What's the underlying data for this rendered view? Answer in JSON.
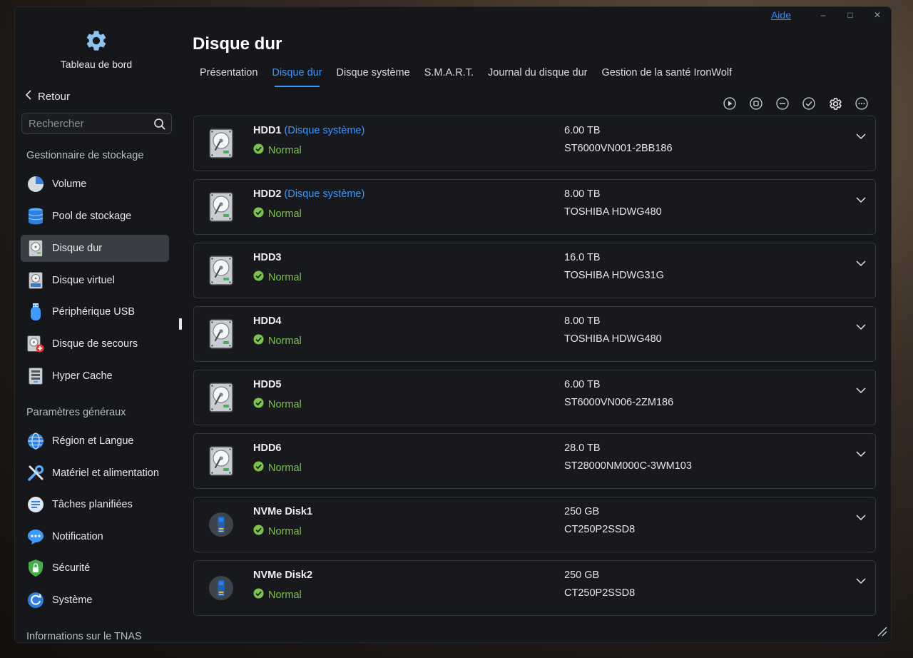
{
  "window": {
    "help_label": "Aide",
    "minimize_glyph": "–",
    "maximize_glyph": "□",
    "close_glyph": "✕"
  },
  "sidebar": {
    "dashboard_label": "Tableau de bord",
    "dashboard_icon": "gear-icon",
    "back_label": "Retour",
    "search_placeholder": "Rechercher",
    "storage_section": "Gestionnaire de stockage",
    "storage_items": [
      {
        "label": "Volume",
        "icon": "volume-pie-icon"
      },
      {
        "label": "Pool de stockage",
        "icon": "storage-pool-icon"
      },
      {
        "label": "Disque dur",
        "icon": "hard-disk-icon",
        "active": true
      },
      {
        "label": "Disque virtuel",
        "icon": "virtual-disk-icon"
      },
      {
        "label": "Périphérique USB",
        "icon": "usb-device-icon"
      },
      {
        "label": "Disque de secours",
        "icon": "spare-disk-icon"
      },
      {
        "label": "Hyper Cache",
        "icon": "hyper-cache-icon"
      }
    ],
    "general_section": "Paramètres généraux",
    "general_items": [
      {
        "label": "Région et Langue",
        "icon": "globe-icon"
      },
      {
        "label": "Matériel et alimentation",
        "icon": "tools-icon"
      },
      {
        "label": "Tâches planifiées",
        "icon": "tasks-icon"
      },
      {
        "label": "Notification",
        "icon": "chat-bubble-icon"
      },
      {
        "label": "Sécurité",
        "icon": "shield-lock-icon"
      },
      {
        "label": "Système",
        "icon": "system-refresh-icon"
      }
    ],
    "info_section": "Informations sur le TNAS"
  },
  "main": {
    "title": "Disque dur",
    "tabs": [
      "Présentation",
      "Disque dur",
      "Disque système",
      "S.M.A.R.T.",
      "Journal du disque dur",
      "Gestion de la santé IronWolf"
    ],
    "active_tab": 1,
    "toolbar_icons": [
      "play-circle-icon",
      "stop-circle-icon",
      "minus-circle-icon",
      "check-circle-icon",
      "gear-icon",
      "more-circle-icon"
    ],
    "disks": [
      {
        "name": "HDD1",
        "tag": "(Disque système)",
        "status": "Normal",
        "size": "6.00 TB",
        "model": "ST6000VN001-2BB186",
        "type": "hdd"
      },
      {
        "name": "HDD2",
        "tag": "(Disque système)",
        "status": "Normal",
        "size": "8.00 TB",
        "model": "TOSHIBA HDWG480",
        "type": "hdd"
      },
      {
        "name": "HDD3",
        "tag": "",
        "status": "Normal",
        "size": "16.0 TB",
        "model": "TOSHIBA HDWG31G",
        "type": "hdd"
      },
      {
        "name": "HDD4",
        "tag": "",
        "status": "Normal",
        "size": "8.00 TB",
        "model": "TOSHIBA HDWG480",
        "type": "hdd"
      },
      {
        "name": "HDD5",
        "tag": "",
        "status": "Normal",
        "size": "6.00 TB",
        "model": "ST6000VN006-2ZM186",
        "type": "hdd"
      },
      {
        "name": "HDD6",
        "tag": "",
        "status": "Normal",
        "size": "28.0 TB",
        "model": "ST28000NM000C-3WM103",
        "type": "hdd"
      },
      {
        "name": "NVMe Disk1",
        "tag": "",
        "status": "Normal",
        "size": "250 GB",
        "model": "CT250P2SSD8",
        "type": "nvme"
      },
      {
        "name": "NVMe Disk2",
        "tag": "",
        "status": "Normal",
        "size": "250 GB",
        "model": "CT250P2SSD8",
        "type": "nvme"
      }
    ]
  },
  "colors": {
    "accent": "#3b95ff",
    "status_ok": "#7cc34b",
    "window_bg": "#15171b",
    "active_nav_bg": "#3a3e44"
  }
}
